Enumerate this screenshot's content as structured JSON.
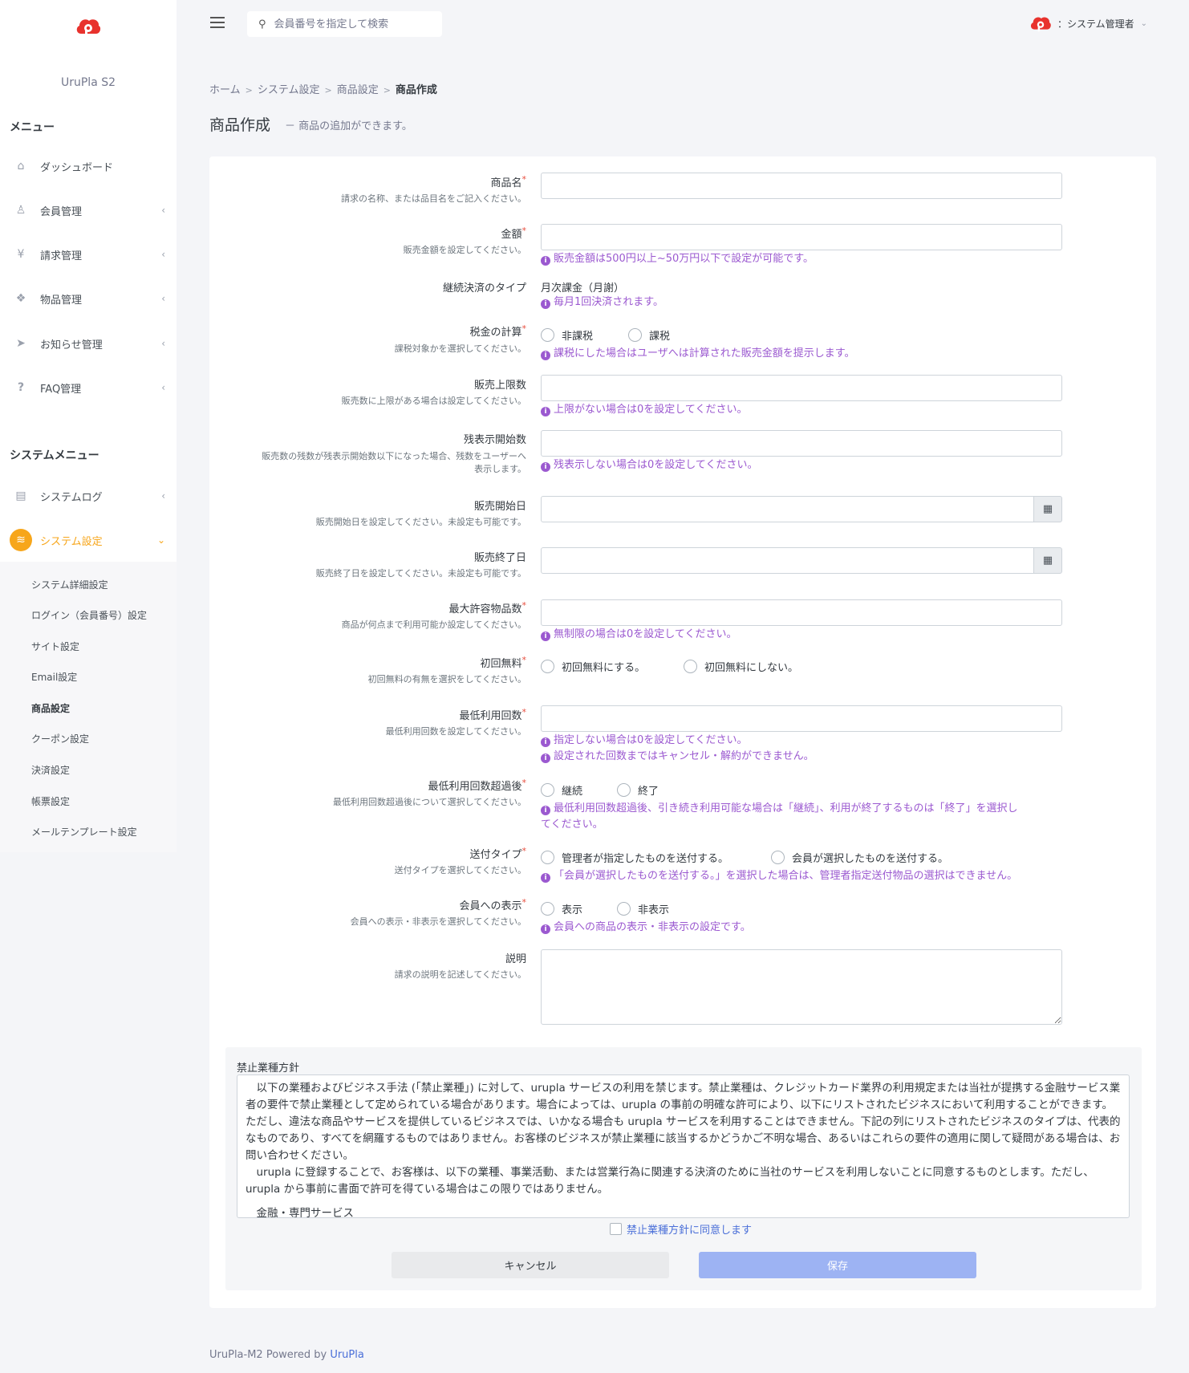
{
  "brand": {
    "name": "UruPla S2",
    "color": "#e8322d"
  },
  "sidebar": {
    "menu_heading": "メニュー",
    "items": [
      {
        "label": "ダッシュボード",
        "icon": "home-icon"
      },
      {
        "label": "会員管理",
        "icon": "user-icon"
      },
      {
        "label": "請求管理",
        "icon": "yen-icon"
      },
      {
        "label": "物品管理",
        "icon": "cubes-icon"
      },
      {
        "label": "お知らせ管理",
        "icon": "paper-plane-icon"
      },
      {
        "label": "FAQ管理",
        "icon": "question-icon"
      }
    ],
    "system_heading": "システムメニュー",
    "system_items": [
      {
        "label": "システムログ",
        "icon": "document-icon"
      },
      {
        "label": "システム設定",
        "icon": "layers-icon"
      }
    ],
    "submenu": [
      "システム詳細設定",
      "ログイン（会員番号）設定",
      "サイト設定",
      "Email設定",
      "商品設定",
      "クーポン設定",
      "決済設定",
      "帳票設定",
      "メールテンプレート設定"
    ],
    "active_color": "#f7a61b"
  },
  "topbar": {
    "search_placeholder": "会員番号を指定して検索",
    "user_name": "：システム管理者"
  },
  "breadcrumb": {
    "home": "ホーム",
    "level1": "システム設定",
    "level2": "商品設定",
    "current": "商品作成"
  },
  "page": {
    "title": "商品作成",
    "subtitle": "－ 商品の追加ができます。"
  },
  "form": {
    "product_name": {
      "label": "商品名",
      "desc": "請求の名称、または品目名をご記入ください。"
    },
    "price": {
      "label": "金額",
      "desc": "販売金額を設定してください。",
      "hint": "販売金額は500円以上~50万円以下で設定が可能です。"
    },
    "billing_type": {
      "label": "継続決済のタイプ",
      "value": "月次課金（月謝）",
      "hint": "毎月1回決済されます。"
    },
    "tax": {
      "label": "税金の計算",
      "desc": "課税対象かを選択してください。",
      "options": [
        "非課税",
        "課税"
      ],
      "hint": "課税にした場合はユーザへは計算された販売金額を提示します。"
    },
    "sales_limit": {
      "label": "販売上限数",
      "desc": "販売数に上限がある場合は設定してください。",
      "hint": "上限がない場合は0を設定してください。"
    },
    "remaining_start": {
      "label": "残表示開始数",
      "desc1": "販売数の残数が残表示開始数以下になった場合、残数をユーザーへ",
      "desc2": "表示します。",
      "hint": "残表示しない場合は0を設定してください。"
    },
    "start_date": {
      "label": "販売開始日",
      "desc": "販売開始日を設定してください。未設定も可能です。"
    },
    "end_date": {
      "label": "販売終了日",
      "desc": "販売終了日を設定してください。未設定も可能です。"
    },
    "max_items": {
      "label": "最大許容物品数",
      "desc": "商品が何点まで利用可能か設定してください。",
      "hint": "無制限の場合は0を設定してください。"
    },
    "first_free": {
      "label": "初回無料",
      "desc": "初回無料の有無を選択をしてください。",
      "options": [
        "初回無料にする。",
        "初回無料にしない。"
      ]
    },
    "min_uses": {
      "label": "最低利用回数",
      "desc": "最低利用回数を設定してください。",
      "hint1": "指定しない場合は0を設定してください。",
      "hint2": "設定された回数まではキャンセル・解約ができません。"
    },
    "after_min": {
      "label": "最低利用回数超過後",
      "desc": "最低利用回数超過後について選択してください。",
      "options": [
        "継続",
        "終了"
      ],
      "hint1": "最低利用回数超過後、引き続き利用可能な場合は「継続」、利用が終了するものは「終了」を選択し",
      "hint2": "てください。"
    },
    "shipping_type": {
      "label": "送付タイプ",
      "desc": "送付タイプを選択してください。",
      "options": [
        "管理者が指定したものを送付する。",
        "会員が選択したものを送付する。"
      ],
      "hint": "「会員が選択したものを送付する。」を選択した場合は、管理者指定送付物品の選択はできません。"
    },
    "visibility": {
      "label": "会員への表示",
      "desc": "会員への表示・非表示を選択してください。",
      "options": [
        "表示",
        "非表示"
      ],
      "hint": "会員への商品の表示・非表示の設定です。"
    },
    "description": {
      "label": "説明",
      "desc": "請求の説明を記述してください。"
    },
    "required_mark": "*"
  },
  "policy": {
    "title": "禁止業種方針",
    "para1": "以下の業種およびビジネス手法 (「禁止業種」) に対して、urupla サービスの利用を禁じます。禁止業種は、クレジットカード業界の利用規定または当社が提携する金融サービス業者の要件で禁止業種として定められている場合があります。場合によっては、urupla の事前の明確な許可により、以下にリストされたビジネスにおいて利用することができます。ただし、違法な商品やサービスを提供しているビジネスでは、いかなる場合も urupla サービスを利用することはできません。下記の列にリストされたビジネスのタイプは、代表的なものであり、すべてを網羅するものではありません。お客様のビジネスが禁止業種に該当するかどうかご不明な場合、あるいはこれらの要件の適用に関して疑問がある場合は、お問い合わせください。",
    "para2": "urupla に登録することで、お客様は、以下の業種、事業活動、または営業行為に関連する決済のために当社のサービスを利用しないことに同意するものとします。ただし、urupla から事前に書面で許可を得ている場合はこの限りではありません。",
    "para3": "金融・専門サービス",
    "agree_label": "禁止業種方針に同意します",
    "cancel_label": "キャンセル",
    "save_label": "保存"
  },
  "footer": {
    "text": "UruPla-M2 Powered by ",
    "link": "UruPla"
  },
  "colors": {
    "hint": "#9b59d0",
    "link": "#4a6fd8",
    "save_button": "#9db3f3"
  }
}
